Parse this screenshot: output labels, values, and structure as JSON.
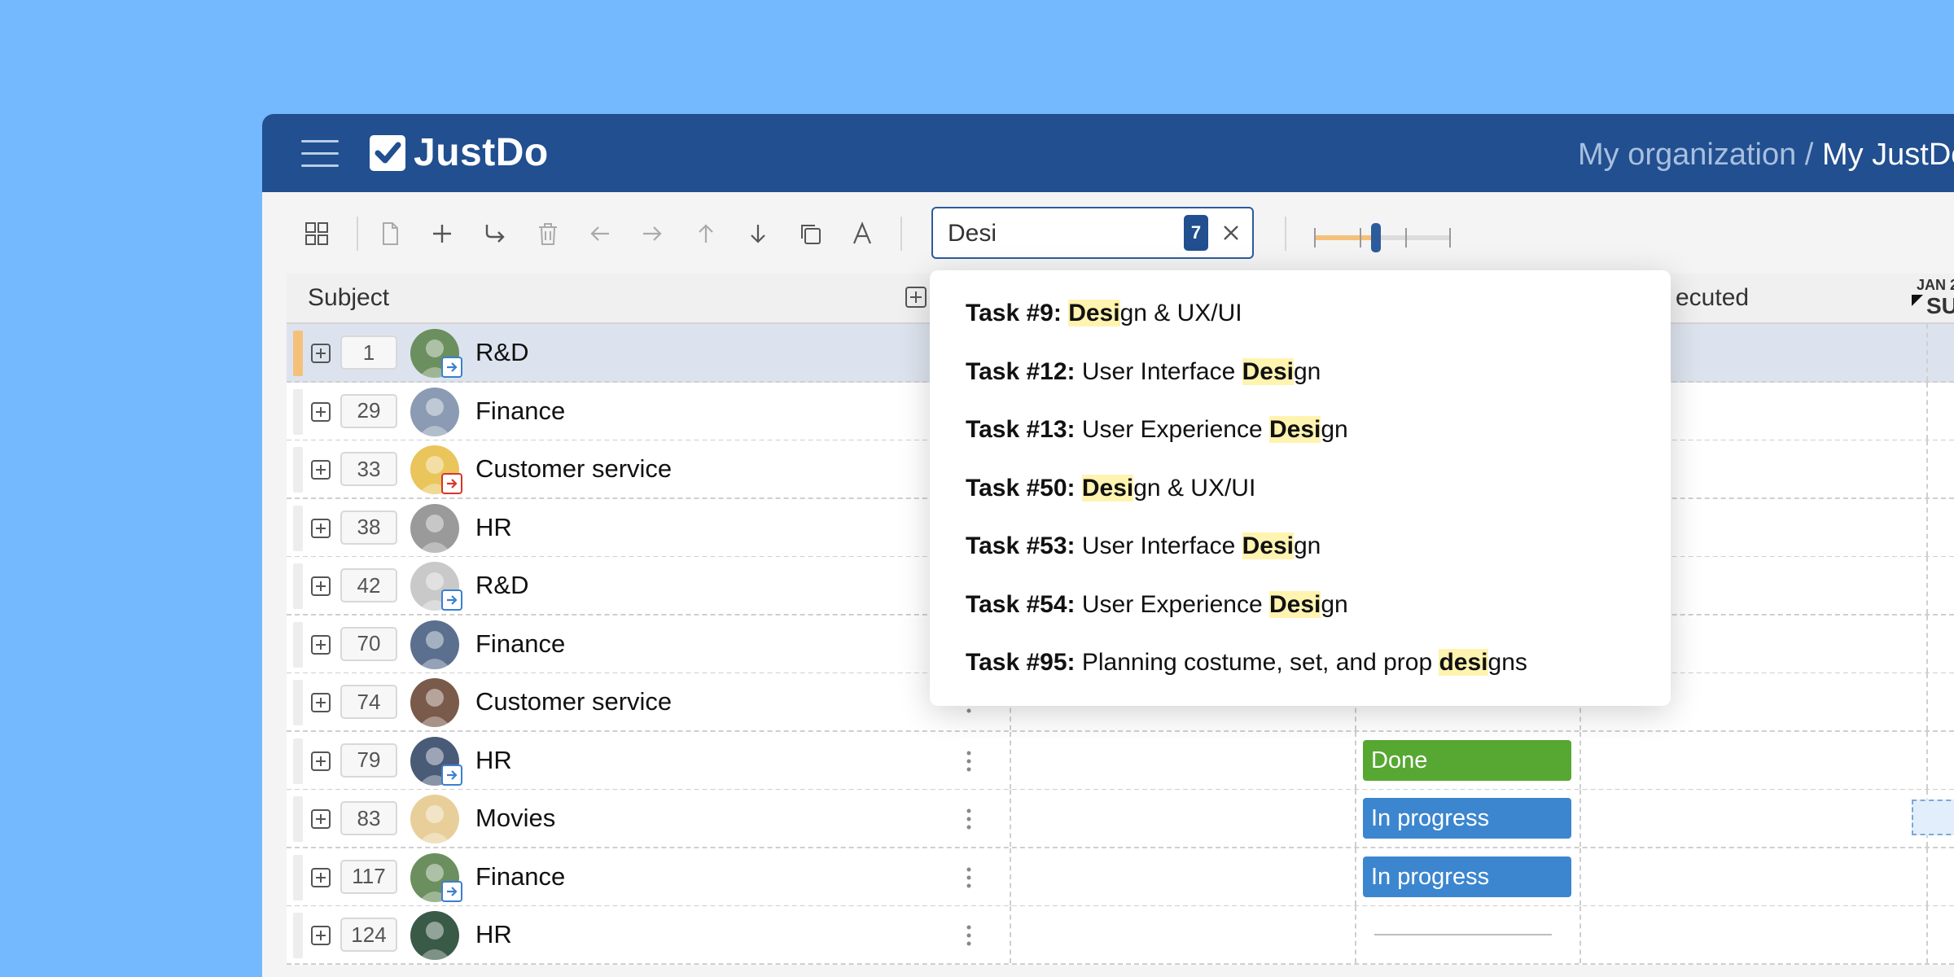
{
  "app": {
    "brand": "JustDo",
    "breadcrumb_org": "My organization /",
    "breadcrumb_current": "My JustDo"
  },
  "search": {
    "value": "Desi",
    "result_count": "7"
  },
  "zoom_slider": {
    "level": 0.45
  },
  "columns": {
    "subject": "Subject",
    "executed": "ecuted"
  },
  "date_header": {
    "month": "JAN 2",
    "day": "SU"
  },
  "rows": [
    {
      "seq": "1",
      "subject": "R&D",
      "status": "",
      "status_type": "none",
      "avatar_bg": "#6b8f5e",
      "badge": "blue"
    },
    {
      "seq": "29",
      "subject": "Finance",
      "status": "",
      "status_type": "none",
      "avatar_bg": "#8a9bb3",
      "badge": ""
    },
    {
      "seq": "33",
      "subject": "Customer service",
      "status": "",
      "status_type": "none",
      "avatar_bg": "#e9c55b",
      "badge": "red"
    },
    {
      "seq": "38",
      "subject": "HR",
      "status": "",
      "status_type": "none",
      "avatar_bg": "#9a9a9a",
      "badge": ""
    },
    {
      "seq": "42",
      "subject": "R&D",
      "status": "",
      "status_type": "none",
      "avatar_bg": "#c9c9c9",
      "badge": "blue"
    },
    {
      "seq": "70",
      "subject": "Finance",
      "status": "",
      "status_type": "none",
      "avatar_bg": "#5b6f8f",
      "badge": ""
    },
    {
      "seq": "74",
      "subject": "Customer service",
      "status": "",
      "status_type": "none",
      "avatar_bg": "#7a5a4a",
      "badge": ""
    },
    {
      "seq": "79",
      "subject": "HR",
      "status": "Done",
      "status_type": "done",
      "avatar_bg": "#4a5b78",
      "badge": "blue"
    },
    {
      "seq": "83",
      "subject": "Movies",
      "status": "In progress",
      "status_type": "prog",
      "avatar_bg": "#e8cf9a",
      "badge": ""
    },
    {
      "seq": "117",
      "subject": "Finance",
      "status": "In progress",
      "status_type": "prog",
      "avatar_bg": "#6b8f5e",
      "badge": "blue"
    },
    {
      "seq": "124",
      "subject": "HR",
      "status": "",
      "status_type": "empty",
      "avatar_bg": "#3a5a48",
      "badge": ""
    }
  ],
  "search_results": [
    {
      "task": "Task #9:",
      "before": " ",
      "match": "Desi",
      "after": "gn & UX/UI"
    },
    {
      "task": "Task #12:",
      "before": " User Interface ",
      "match": "Desi",
      "after": "gn"
    },
    {
      "task": "Task #13:",
      "before": " User Experience ",
      "match": "Desi",
      "after": "gn"
    },
    {
      "task": "Task #50:",
      "before": " ",
      "match": "Desi",
      "after": "gn & UX/UI"
    },
    {
      "task": "Task #53:",
      "before": " User Interface ",
      "match": "Desi",
      "after": "gn"
    },
    {
      "task": "Task #54:",
      "before": " User Experience ",
      "match": "Desi",
      "after": "gn"
    },
    {
      "task": "Task #95:",
      "before": " Planning costume, set, and prop ",
      "match": "desi",
      "after": "gns"
    }
  ],
  "colors": {
    "topbar": "#214f8f",
    "done": "#57a733",
    "in_progress": "#3c86cf",
    "highlight": "#fff3b0"
  }
}
